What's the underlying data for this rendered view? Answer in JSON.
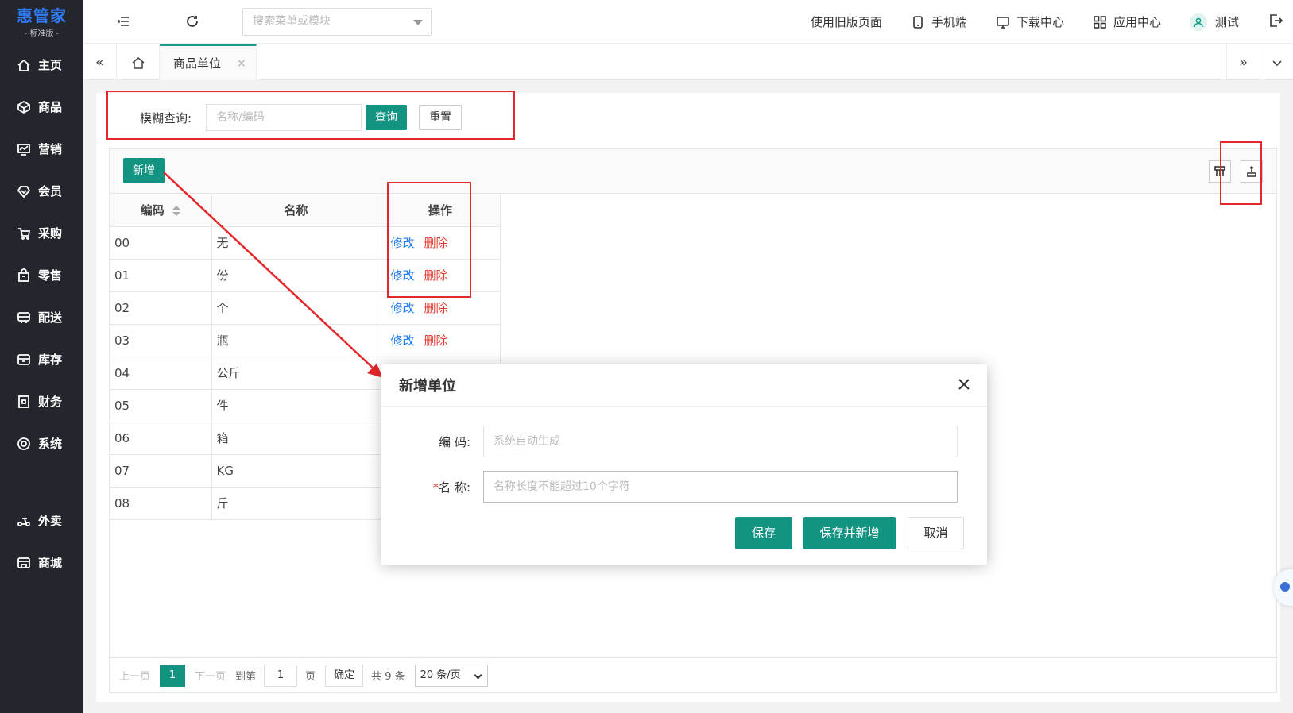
{
  "logo": {
    "title": "惠管家",
    "subtitle": "- 标准版 -"
  },
  "sidebar": {
    "items": [
      {
        "label": "主页",
        "icon": "home-icon"
      },
      {
        "label": "商品",
        "icon": "box-icon"
      },
      {
        "label": "营销",
        "icon": "chart-icon"
      },
      {
        "label": "会员",
        "icon": "diamond-icon"
      },
      {
        "label": "采购",
        "icon": "cart-icon"
      },
      {
        "label": "零售",
        "icon": "bag-icon"
      },
      {
        "label": "配送",
        "icon": "truck-icon"
      },
      {
        "label": "库存",
        "icon": "warehouse-icon"
      },
      {
        "label": "财务",
        "icon": "finance-icon"
      },
      {
        "label": "系统",
        "icon": "settings-icon"
      },
      {
        "label": "外卖",
        "icon": "scooter-icon"
      },
      {
        "label": "商城",
        "icon": "store-icon"
      }
    ]
  },
  "header": {
    "menu_search_placeholder": "搜索菜单或模块",
    "old_page": "使用旧版页面",
    "mobile": "手机端",
    "download": "下载中心",
    "apps": "应用中心",
    "user": "测试"
  },
  "tabs": {
    "active_label": "商品单位",
    "close_symbol": "×"
  },
  "search": {
    "label": "模糊查询:",
    "placeholder": "名称/编码",
    "query_button": "查询",
    "reset_button": "重置"
  },
  "table": {
    "add_button": "新增",
    "columns": [
      "编码",
      "名称",
      "操作"
    ],
    "edit_label": "修改",
    "delete_label": "删除",
    "rows": [
      {
        "code": "00",
        "name": "无"
      },
      {
        "code": "01",
        "name": "份"
      },
      {
        "code": "02",
        "name": "个"
      },
      {
        "code": "03",
        "name": "瓶"
      },
      {
        "code": "04",
        "name": "公斤"
      },
      {
        "code": "05",
        "name": "件"
      },
      {
        "code": "06",
        "name": "箱"
      },
      {
        "code": "07",
        "name": "KG"
      },
      {
        "code": "08",
        "name": "斤"
      }
    ]
  },
  "pager": {
    "prev": "上一页",
    "current": "1",
    "next": "下一页",
    "goto": "到第",
    "page_input": "1",
    "page_unit": "页",
    "confirm": "确定",
    "total": "共 9 条",
    "page_size": "20 条/页"
  },
  "modal": {
    "title": "新增单位",
    "code_label": "编 码:",
    "code_placeholder": "系统自动生成",
    "name_required": "*",
    "name_label": "名 称:",
    "name_placeholder": "名称长度不能超过10个字符",
    "save": "保存",
    "save_and_new": "保存并新增",
    "cancel": "取消"
  },
  "colors": {
    "accent": "#139482",
    "annotation": "#e5262a",
    "sidebar": "#24262d",
    "link": "#1e7cf0",
    "danger": "#e33b2e"
  }
}
